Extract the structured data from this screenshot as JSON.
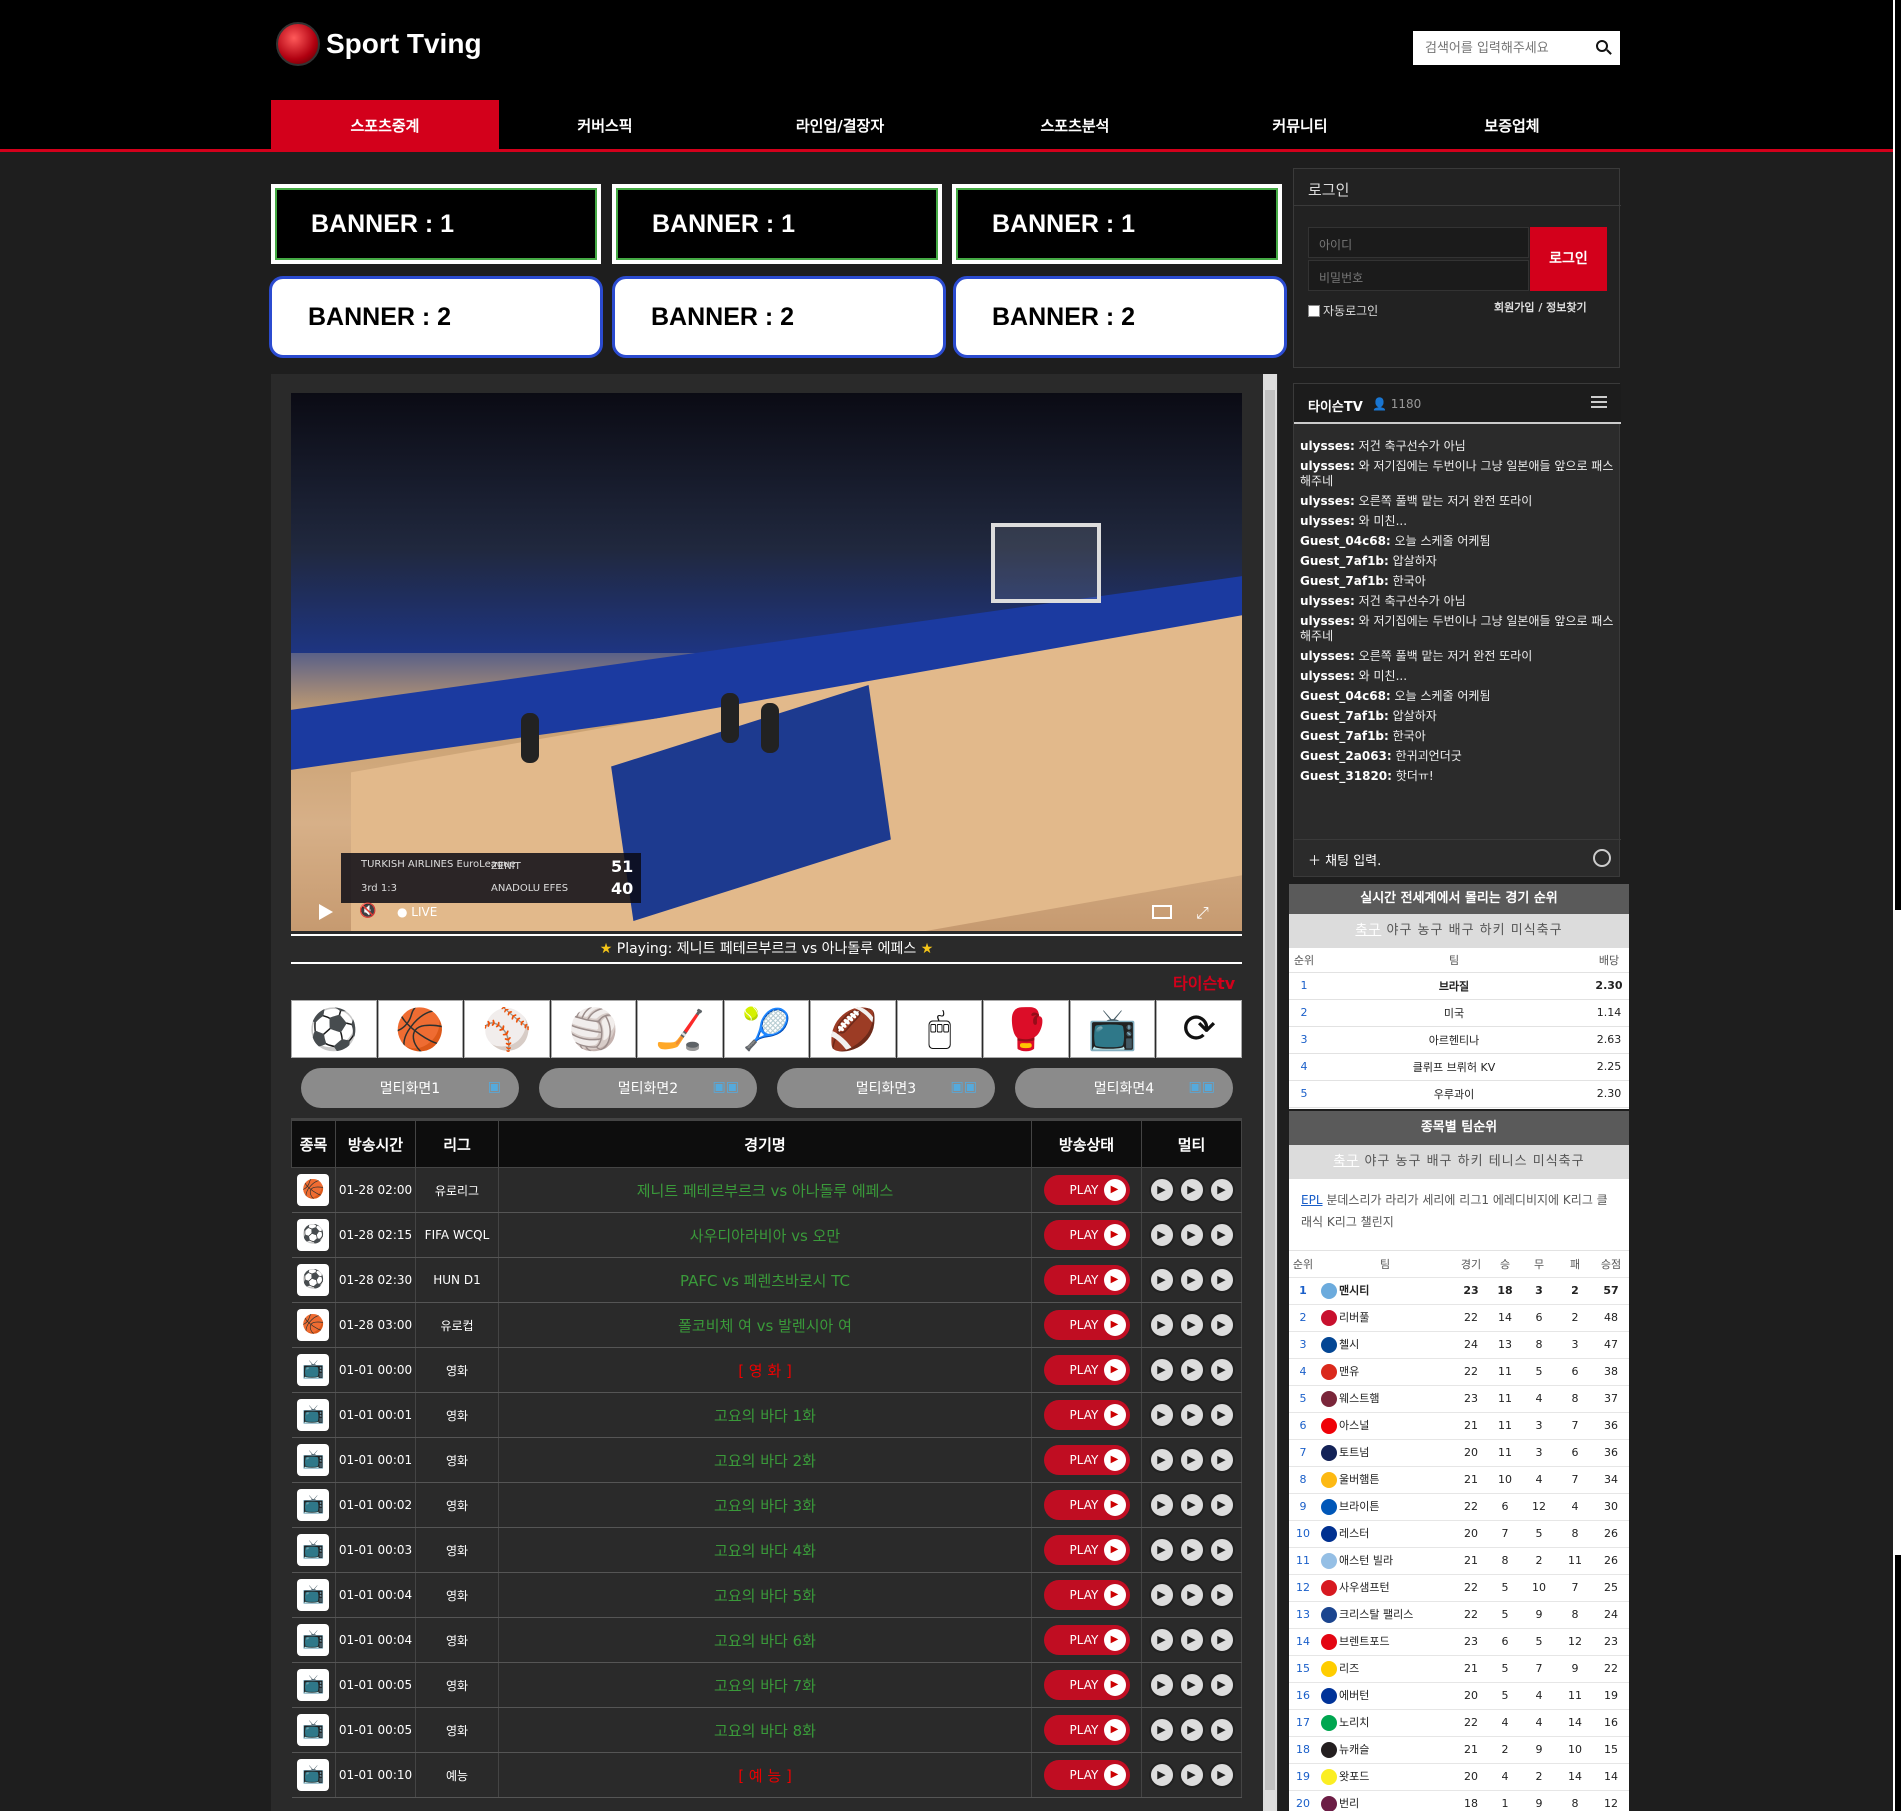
{
  "header": {
    "logo_text": "Sport Tving",
    "search_placeholder": "검색어를 입력해주세요"
  },
  "nav": {
    "items": [
      "스포츠중계",
      "커버스픽",
      "라인업/결장자",
      "스포츠분석",
      "커뮤니티",
      "보증업체"
    ],
    "active_index": 0
  },
  "banners": {
    "row1": [
      "BANNER : 1",
      "BANNER : 1",
      "BANNER : 1"
    ],
    "row2": [
      "BANNER : 2",
      "BANNER : 2",
      "BANNER : 2"
    ]
  },
  "player": {
    "overlay": {
      "league": "TURKISH AIRLINES EuroLeague",
      "quarter": "3rd",
      "clock": "1:3",
      "team_home": "ZENIT",
      "team_away": "ANADOLU EFES",
      "score_home": "51",
      "score_away": "40",
      "live_label": "LIVE"
    },
    "playing_prefix": "Playing:",
    "playing_title": "제니트 페테르부르크 vs 아나돌루 에페스",
    "channel": "타이슨tv"
  },
  "sport_icons": [
    "soccer-icon",
    "basketball-icon",
    "baseball-icon",
    "volleyball-icon",
    "hockey-icon",
    "tennis-icon",
    "football-icon",
    "esports-icon",
    "ufc-icon",
    "tv-icon",
    "refresh-icon"
  ],
  "multi_buttons": [
    "멀티화면1",
    "멀티화면2",
    "멀티화면3",
    "멀티화면4"
  ],
  "games_table": {
    "headers": [
      "종목",
      "방송시간",
      "리그",
      "경기명",
      "방송상태",
      "멀티"
    ],
    "play_label": "PLAY",
    "rows": [
      {
        "icon": "basketball-icon",
        "time": "01-28 02:00",
        "league": "유로리그",
        "title": "제니트 페테르부르크 vs 아나돌루 에페스",
        "red": false
      },
      {
        "icon": "soccer-icon",
        "time": "01-28 02:15",
        "league": "FIFA WCQL",
        "title": "사우디아라비아 vs 오만",
        "red": false
      },
      {
        "icon": "soccer-icon",
        "time": "01-28 02:30",
        "league": "HUN D1",
        "title": "PAFC vs 페렌츠바로시 TC",
        "red": false
      },
      {
        "icon": "basketball-icon",
        "time": "01-28 03:00",
        "league": "유로컵",
        "title": "폴코비체 여 vs 발렌시아 여",
        "red": false
      },
      {
        "icon": "tv-icon",
        "time": "01-01 00:00",
        "league": "영화",
        "title": "[ 영 화 ]",
        "red": true
      },
      {
        "icon": "tv-icon",
        "time": "01-01 00:01",
        "league": "영화",
        "title": "고요의 바다 1화",
        "red": false
      },
      {
        "icon": "tv-icon",
        "time": "01-01 00:01",
        "league": "영화",
        "title": "고요의 바다 2화",
        "red": false
      },
      {
        "icon": "tv-icon",
        "time": "01-01 00:02",
        "league": "영화",
        "title": "고요의 바다 3화",
        "red": false
      },
      {
        "icon": "tv-icon",
        "time": "01-01 00:03",
        "league": "영화",
        "title": "고요의 바다 4화",
        "red": false
      },
      {
        "icon": "tv-icon",
        "time": "01-01 00:04",
        "league": "영화",
        "title": "고요의 바다 5화",
        "red": false
      },
      {
        "icon": "tv-icon",
        "time": "01-01 00:04",
        "league": "영화",
        "title": "고요의 바다 6화",
        "red": false
      },
      {
        "icon": "tv-icon",
        "time": "01-01 00:05",
        "league": "영화",
        "title": "고요의 바다 7화",
        "red": false
      },
      {
        "icon": "tv-icon",
        "time": "01-01 00:05",
        "league": "영화",
        "title": "고요의 바다 8화",
        "red": false
      },
      {
        "icon": "tv-icon",
        "time": "01-01 00:10",
        "league": "예능",
        "title": "[ 예 능 ]",
        "red": true
      }
    ]
  },
  "login": {
    "title": "로그인",
    "id_placeholder": "아이디",
    "pw_placeholder": "비밀번호",
    "button": "로그인",
    "auto_login": "자동로그인",
    "join": "회원가입",
    "find": "정보찾기"
  },
  "chat": {
    "room": "타이슨TV",
    "viewers": "1180",
    "input_label": "채팅 입력.",
    "messages": [
      {
        "user": "ulysses:",
        "text": " 저건 축구선수가 아님"
      },
      {
        "user": "ulysses:",
        "text": " 와 저기집에는 두번이나 그냥 일본애들 앞으로 패스해주네"
      },
      {
        "user": "ulysses:",
        "text": " 오른쪽 풀백 맡는 저거 완전 또라이"
      },
      {
        "user": "ulysses:",
        "text": " 와 미친..."
      },
      {
        "user": "Guest_04c68:",
        "text": " 오늘 스케줄 어케됨"
      },
      {
        "user": "Guest_7af1b:",
        "text": " 압살하자"
      },
      {
        "user": "Guest_7af1b:",
        "text": " 한국아"
      },
      {
        "user": "ulysses:",
        "text": " 저건 축구선수가 아님"
      },
      {
        "user": "ulysses:",
        "text": " 와 저기집에는 두번이나 그냥 일본애들 앞으로 패스해주네"
      },
      {
        "user": "ulysses:",
        "text": " 오른쪽 풀백 맡는 저거 완전 또라이"
      },
      {
        "user": "ulysses:",
        "text": " 와 미친..."
      },
      {
        "user": "Guest_04c68:",
        "text": " 오늘 스케줄 어케됨"
      },
      {
        "user": "Guest_7af1b:",
        "text": " 압살하자"
      },
      {
        "user": "Guest_7af1b:",
        "text": " 한국아"
      },
      {
        "user": "Guest_2a063:",
        "text": " 한귀괴언더굿"
      },
      {
        "user": "Guest_31820:",
        "text": " 핫더ㅠ!"
      }
    ]
  },
  "rank_world": {
    "title": "실시간 전세계에서 몰리는 경기 순위",
    "tabs": [
      "축구",
      "야구",
      "농구",
      "배구",
      "하키",
      "미식축구"
    ],
    "active_tab": 0,
    "headers": [
      "순위",
      "팀",
      "배당"
    ],
    "rows": [
      {
        "rank": "1",
        "team": "브라질",
        "odds": "2.30"
      },
      {
        "rank": "2",
        "team": "미국",
        "odds": "1.14"
      },
      {
        "rank": "3",
        "team": "아르헨티나",
        "odds": "2.63"
      },
      {
        "rank": "4",
        "team": "클뤼프 브뤼허 KV",
        "odds": "2.25"
      },
      {
        "rank": "5",
        "team": "우루과이",
        "odds": "2.30"
      }
    ]
  },
  "rank_team": {
    "title": "종목별 팀순위",
    "tabs": [
      "축구",
      "야구",
      "농구",
      "배구",
      "하키",
      "테니스",
      "미식축구"
    ],
    "active_tab": 0,
    "leagues": [
      "EPL",
      "분데스리가",
      "라리가",
      "세리에",
      "리그1",
      "에레디비지에",
      "K리그 클래식",
      "K리그 챌린지"
    ],
    "headers": [
      "순위",
      "팀",
      "경기",
      "승",
      "무",
      "패",
      "승점"
    ],
    "rows": [
      {
        "rank": "1",
        "team": "맨시티",
        "p": "23",
        "w": "18",
        "d": "3",
        "l": "2",
        "pts": "57",
        "color": "#6cabdd"
      },
      {
        "rank": "2",
        "team": "리버풀",
        "p": "22",
        "w": "14",
        "d": "6",
        "l": "2",
        "pts": "48",
        "color": "#c8102e"
      },
      {
        "rank": "3",
        "team": "첼시",
        "p": "24",
        "w": "13",
        "d": "8",
        "l": "3",
        "pts": "47",
        "color": "#034694"
      },
      {
        "rank": "4",
        "team": "맨유",
        "p": "22",
        "w": "11",
        "d": "5",
        "l": "6",
        "pts": "38",
        "color": "#da291c"
      },
      {
        "rank": "5",
        "team": "웨스트햄",
        "p": "23",
        "w": "11",
        "d": "4",
        "l": "8",
        "pts": "37",
        "color": "#7a263a"
      },
      {
        "rank": "6",
        "team": "아스널",
        "p": "21",
        "w": "11",
        "d": "3",
        "l": "7",
        "pts": "36",
        "color": "#ef0107"
      },
      {
        "rank": "7",
        "team": "토트넘",
        "p": "20",
        "w": "11",
        "d": "3",
        "l": "6",
        "pts": "36",
        "color": "#132257"
      },
      {
        "rank": "8",
        "team": "울버햄튼",
        "p": "21",
        "w": "10",
        "d": "4",
        "l": "7",
        "pts": "34",
        "color": "#fdb913"
      },
      {
        "rank": "9",
        "team": "브라이튼",
        "p": "22",
        "w": "6",
        "d": "12",
        "l": "4",
        "pts": "30",
        "color": "#0057b8"
      },
      {
        "rank": "10",
        "team": "레스터",
        "p": "20",
        "w": "7",
        "d": "5",
        "l": "8",
        "pts": "26",
        "color": "#003090"
      },
      {
        "rank": "11",
        "team": "애스턴 빌라",
        "p": "21",
        "w": "8",
        "d": "2",
        "l": "11",
        "pts": "26",
        "color": "#95bfe5"
      },
      {
        "rank": "12",
        "team": "사우샘프턴",
        "p": "22",
        "w": "5",
        "d": "10",
        "l": "7",
        "pts": "25",
        "color": "#d71920"
      },
      {
        "rank": "13",
        "team": "크리스탈 팰리스",
        "p": "22",
        "w": "5",
        "d": "9",
        "l": "8",
        "pts": "24",
        "color": "#1b458f"
      },
      {
        "rank": "14",
        "team": "브렌트포드",
        "p": "23",
        "w": "6",
        "d": "5",
        "l": "12",
        "pts": "23",
        "color": "#e30613"
      },
      {
        "rank": "15",
        "team": "리즈",
        "p": "21",
        "w": "5",
        "d": "7",
        "l": "9",
        "pts": "22",
        "color": "#ffcd00"
      },
      {
        "rank": "16",
        "team": "에버턴",
        "p": "20",
        "w": "5",
        "d": "4",
        "l": "11",
        "pts": "19",
        "color": "#003399"
      },
      {
        "rank": "17",
        "team": "노리치",
        "p": "22",
        "w": "4",
        "d": "4",
        "l": "14",
        "pts": "16",
        "color": "#00a650"
      },
      {
        "rank": "18",
        "team": "뉴캐슬",
        "p": "21",
        "w": "2",
        "d": "9",
        "l": "10",
        "pts": "15",
        "color": "#241f20"
      },
      {
        "rank": "19",
        "team": "왓포드",
        "p": "20",
        "w": "4",
        "d": "2",
        "l": "14",
        "pts": "14",
        "color": "#fbee23"
      },
      {
        "rank": "20",
        "team": "번리",
        "p": "18",
        "w": "1",
        "d": "9",
        "l": "8",
        "pts": "12",
        "color": "#6c1d45"
      }
    ]
  }
}
